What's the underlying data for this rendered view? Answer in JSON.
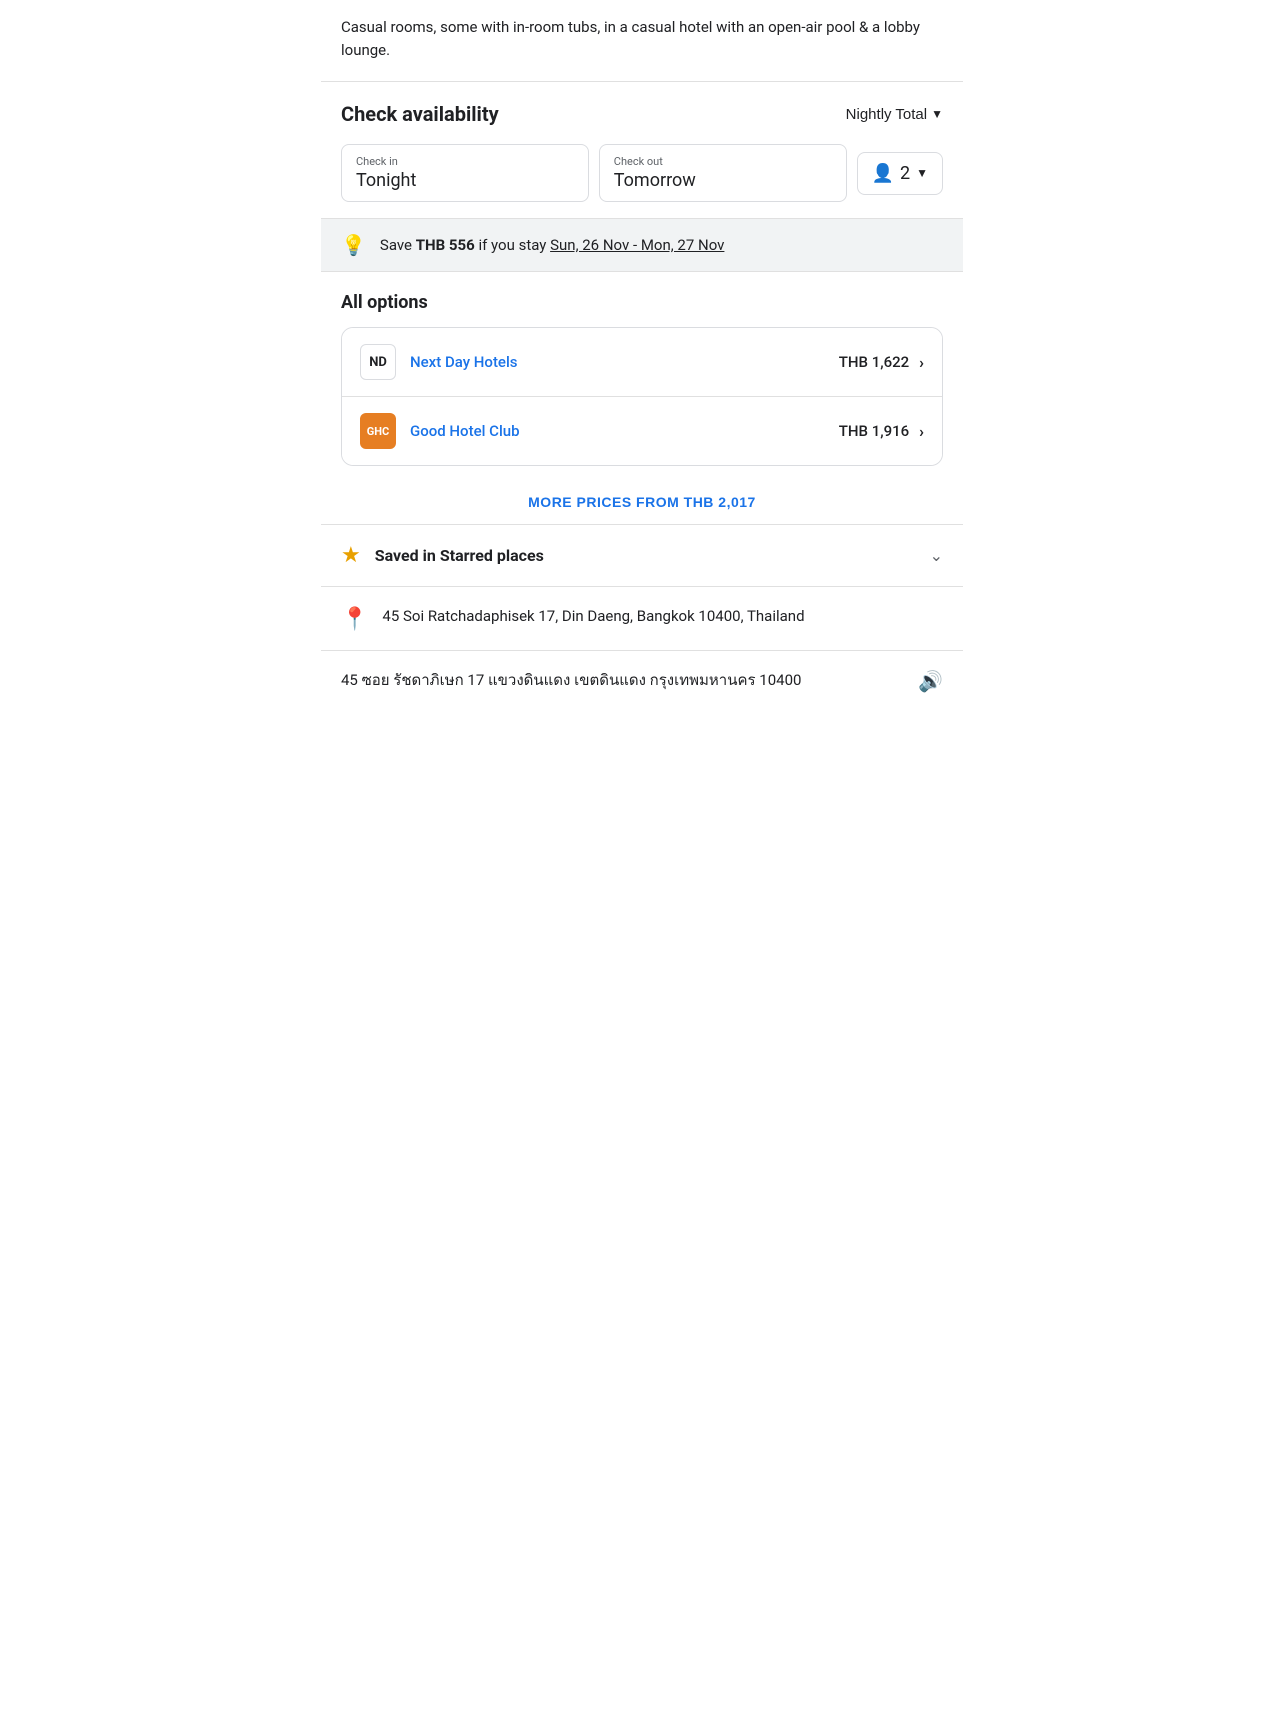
{
  "description": {
    "text": "Casual rooms, some with in-room tubs, in a casual hotel with an open-air pool & a lobby lounge."
  },
  "check_availability": {
    "title": "Check availability",
    "nightly_total_label": "Nightly Total",
    "check_in_label": "Check in",
    "check_in_value": "Tonight",
    "check_out_label": "Check out",
    "check_out_value": "Tomorrow",
    "guests_value": "2"
  },
  "savings_banner": {
    "icon": "💡",
    "prefix": "Save ",
    "amount": "THB 556",
    "middle": " if you stay ",
    "date_range": "Sun, 26 Nov - Mon, 27 Nov"
  },
  "all_options": {
    "title": "All options",
    "options": [
      {
        "logo_text": "ND",
        "logo_type": "nd",
        "name": "Next Day Hotels",
        "price": "THB 1,622"
      },
      {
        "logo_text": "GHC",
        "logo_type": "ghc",
        "name": "Good Hotel Club",
        "price": "THB 1,916"
      }
    ],
    "more_prices_label": "MORE PRICES FROM THB 2,017"
  },
  "starred": {
    "label": "Saved in Starred places"
  },
  "address": {
    "english": "45 Soi Ratchadaphisek 17, Din Daeng, Bangkok 10400, Thailand",
    "thai": "45 ซอย รัชดาภิเษก 17 แขวงดินแดง เขตดินแดง กรุงเทพมหานคร 10400"
  }
}
